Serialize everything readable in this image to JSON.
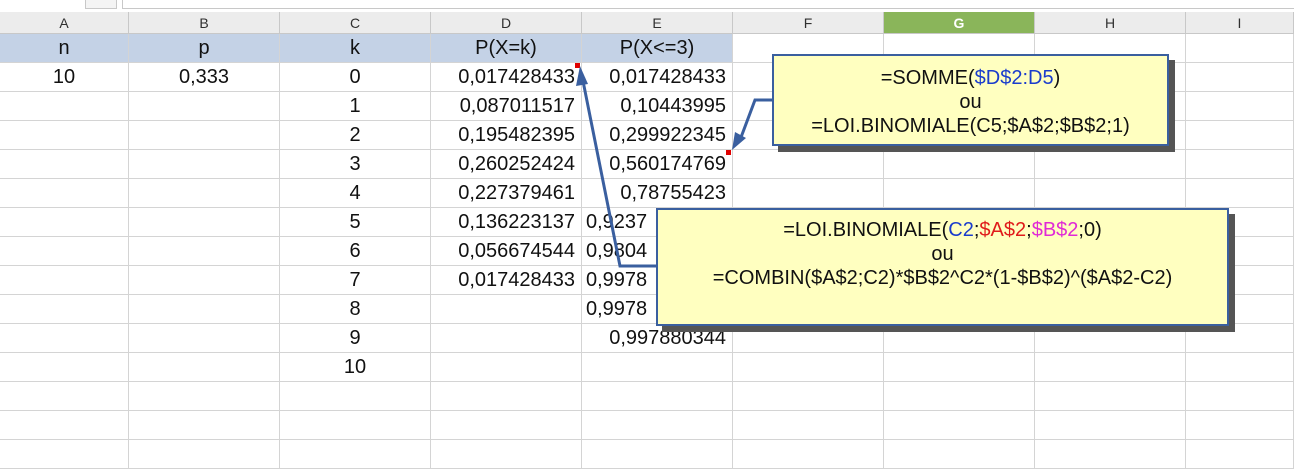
{
  "columns": [
    "A",
    "B",
    "C",
    "D",
    "E",
    "F",
    "G",
    "H",
    "I"
  ],
  "selected_column": "G",
  "header_row": {
    "A": "n",
    "B": "p",
    "C": "k",
    "D": "P(X=k)",
    "E": "P(X<=3)"
  },
  "row2": {
    "A": "10",
    "B": "0,333"
  },
  "k_values": [
    "0",
    "1",
    "2",
    "3",
    "4",
    "5",
    "6",
    "7",
    "8",
    "9",
    "10"
  ],
  "pxk_values": [
    "0,017428433",
    "0,087011517",
    "0,195482395",
    "0,260252424",
    "0,227379461",
    "0,136223137",
    "0,056674544",
    "0,017428433"
  ],
  "cumulative_values": [
    "0,017428433",
    "0,10443995",
    "0,299922345",
    "0,560174769",
    "0,78755423",
    "0,9237",
    "0,9804",
    "0,9978",
    "0,9978",
    "0,997880344"
  ],
  "comment1": {
    "line1_prefix": "=SOMME(",
    "line1_ref": "$D$2:D5",
    "line1_suffix": ")",
    "line2": "ou",
    "line3": "=LOI.BINOMIALE(C5;$A$2;$B$2;1)"
  },
  "comment2": {
    "line1_prefix": "=LOI.BINOMIALE(",
    "line1_c2": "C2",
    "line1_sep1": ";",
    "line1_a2": "$A$2",
    "line1_sep2": ";",
    "line1_b2": "$B$2",
    "line1_suffix": ";0)",
    "line2": "ou",
    "line3": "=COMBIN($A$2;C2)*$B$2^C2*(1-$B$2)^($A$2-C2)"
  },
  "colors": {
    "header_band": "#c4d2e6",
    "selected_header": "#8ab55a",
    "comment_bg": "#ffffc0",
    "comment_border": "#3a5f9f",
    "marker": "#e00000"
  }
}
